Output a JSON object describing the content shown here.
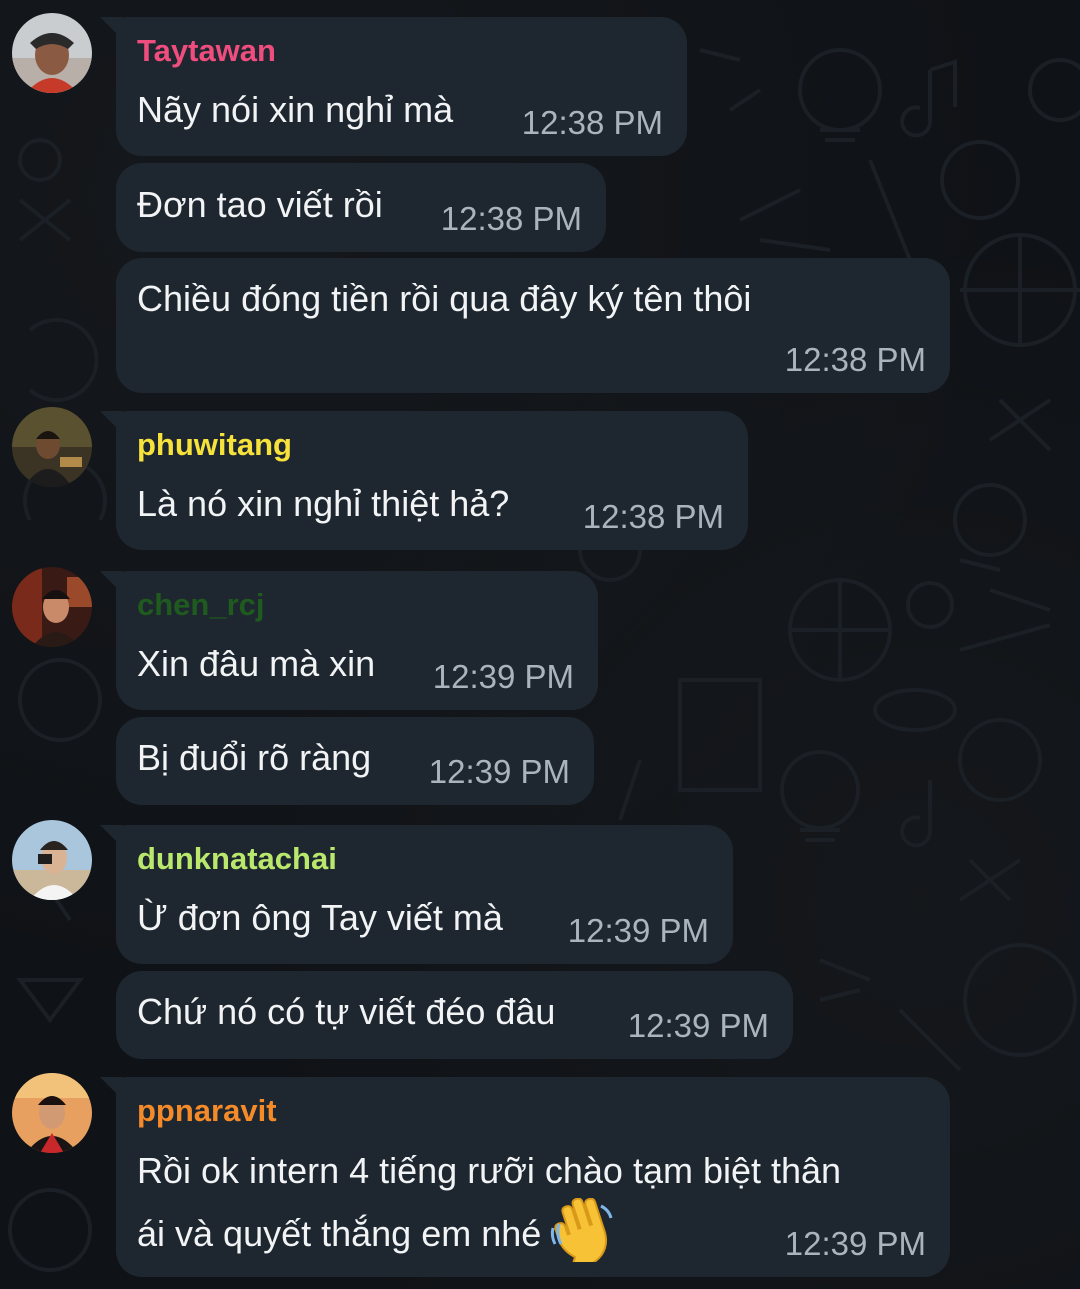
{
  "colors": {
    "bubble": "#1e272f",
    "background": "#0f1216",
    "time": "#a9b4bd",
    "sender_taytawan": "#ef4d7e",
    "sender_phuwitang": "#f7e23c",
    "sender_chen": "#1f5a1f",
    "sender_dunk": "#b9e86c",
    "sender_ppnaravit": "#f58a28"
  },
  "messages": [
    {
      "sender": "Taytawan",
      "text": "Nãy nói xin nghỉ mà",
      "time": "12:38 PM"
    },
    {
      "text": "Đơn tao viết rồi",
      "time": "12:38 PM"
    },
    {
      "text": "Chiều đóng tiền rồi qua đây ký tên thôi",
      "time": "12:38 PM"
    },
    {
      "sender": "phuwitang",
      "text": "Là nó xin nghỉ thiệt hả?",
      "time": "12:38 PM"
    },
    {
      "sender": "chen_rcj",
      "text": "Xin đâu mà xin",
      "time": "12:39 PM"
    },
    {
      "text": "Bị đuổi rõ ràng",
      "time": "12:39 PM"
    },
    {
      "sender": "dunknatachai",
      "text": "Ừ đơn ông Tay viết mà",
      "time": "12:39 PM"
    },
    {
      "text": "Chứ nó có tự viết đéo đâu",
      "time": "12:39 PM"
    },
    {
      "sender": "ppnaravit",
      "text_line1": "Rồi ok intern 4 tiếng rưỡi chào tạm biệt thân",
      "text_line2": "ái và quyết thắng em nhé",
      "emoji": "waving-hand",
      "time": "12:39 PM"
    }
  ]
}
